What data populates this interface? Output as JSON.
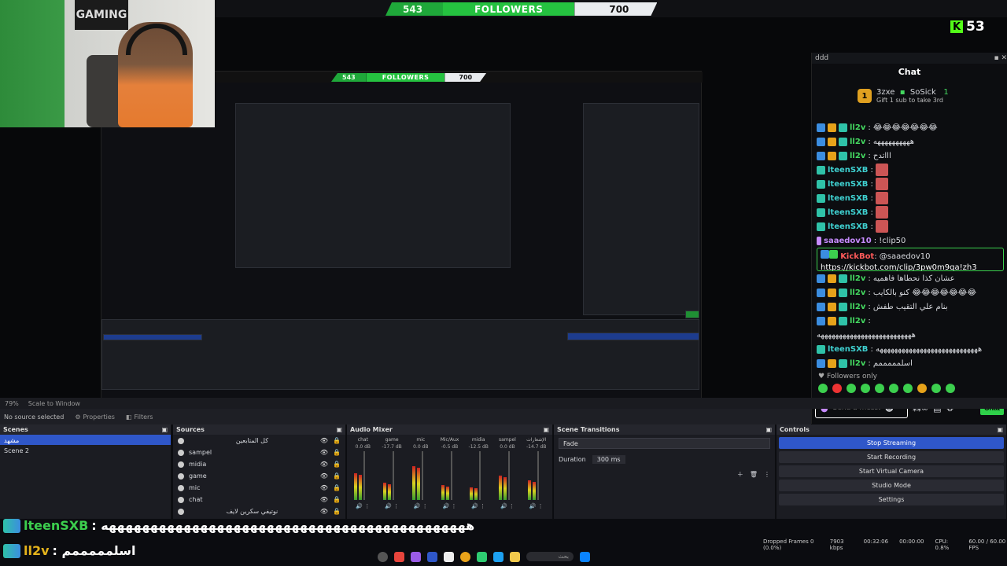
{
  "followers_bar": {
    "current": "543",
    "label": "FOLLOWERS",
    "goal": "700"
  },
  "nested_followers_bar": {
    "current": "543",
    "label": "FOLLOWERS",
    "goal": "700"
  },
  "webcam": {
    "sign_text": "GAMING"
  },
  "kick": {
    "logo": "K",
    "count": "53"
  },
  "chat": {
    "dock_title": "ddd",
    "heading": "Chat",
    "pinned": {
      "badge": "1",
      "user": "3zxe",
      "user2": "SoSick",
      "rank": "1",
      "gift_text": "Gift 1 sub to take 3rd"
    },
    "messages": [
      {
        "user": "ll2v",
        "text": ": 😂😂😂😂😂😂😂",
        "color": "n-green"
      },
      {
        "user": "ll2v",
        "text": ": ههههههههههه",
        "color": "n-green"
      },
      {
        "user": "ll2v",
        "text": ": اااتدح",
        "color": "n-green"
      },
      {
        "user": "lteenSXB",
        "text": ":",
        "color": "n-cyan"
      },
      {
        "user": "lteenSXB",
        "text": ":",
        "color": "n-cyan"
      },
      {
        "user": "lteenSXB",
        "text": ":",
        "color": "n-cyan"
      },
      {
        "user": "lteenSXB",
        "text": ":",
        "color": "n-cyan"
      },
      {
        "user": "lteenSXB",
        "text": ":",
        "color": "n-cyan"
      },
      {
        "user": "saaedov10",
        "text": ": !clip50",
        "color": "n-purple"
      }
    ],
    "highlight": {
      "user": "KickBot",
      "text": ": @saaedov10",
      "link": "https://kickbot.com/clip/3pw0m9qa!zh3"
    },
    "messages2": [
      {
        "user": "ll2v",
        "text": ": عشان كذا نحطاها فاهميه",
        "color": "n-green"
      },
      {
        "user": "ll2v",
        "text": ": كنو بالكايب 😂😂😂😂😂😂😂",
        "color": "n-green"
      },
      {
        "user": "ll2v",
        "text": ": بنام علي التقيب طفش",
        "color": "n-green"
      },
      {
        "user": "ll2v",
        "text": ":",
        "color": "n-green"
      },
      {
        "user": "",
        "text": "ههههههههههههههههههههههههههه",
        "color": "n-green"
      },
      {
        "user": "lteenSXB",
        "text": ": ههههههههههههههههههههههههههههه",
        "color": "n-cyan"
      },
      {
        "user": "ll2v",
        "text": ": اسلمممممم",
        "color": "n-green"
      }
    ],
    "followers_only": "Followers only",
    "composer_placeholder": "Send a message",
    "chat_button": "Chat"
  },
  "obs": {
    "zoom": "79%",
    "scale": "Scale to Window",
    "no_source": "No source selected",
    "properties": "Properties",
    "filters": "Filters",
    "scenes_title": "Scenes",
    "scenes": [
      "مشهد",
      "Scene 2"
    ],
    "sources_title": "Sources",
    "sources": [
      "كل المتابعين",
      "sampel",
      "midia",
      "game",
      "mic",
      "chat",
      "نوتيفي سكرين لايف"
    ],
    "mixer_title": "Audio Mixer",
    "mixer": [
      {
        "name": "chat",
        "db": "0.0 dB",
        "level": 0.55
      },
      {
        "name": "game",
        "db": "-17.7 dB",
        "level": 0.35
      },
      {
        "name": "mic",
        "db": "0.0 dB",
        "level": 0.7
      },
      {
        "name": "Mic/Aux",
        "db": "-0.5 dB",
        "level": 0.3
      },
      {
        "name": "midia",
        "db": "-12.5 dB",
        "level": 0.25
      },
      {
        "name": "sampel",
        "db": "0.0 dB",
        "level": 0.5
      },
      {
        "name": "الإشعارات",
        "db": "-14.7 dB",
        "level": 0.4
      }
    ],
    "transitions_title": "Scene Transitions",
    "transition": "Fade",
    "duration_label": "Duration",
    "duration": "300 ms",
    "controls_title": "Controls",
    "controls": [
      "Stop Streaming",
      "Start Recording",
      "Start Virtual Camera",
      "Studio Mode",
      "Settings"
    ],
    "status": {
      "dropped": "Dropped Frames 0 (0.0%)",
      "kbps": "7903 kbps",
      "time": "00:32:06",
      "rec": "00:00:00",
      "cpu": "CPU: 0.8%",
      "fps": "60.00 / 60.00 FPS"
    }
  },
  "overlay": {
    "line1_user": "lteenSXB",
    "line1_text": ": ههههههههههههههههههههههههههههههههههههههههههههه",
    "line2_user": "ll2v",
    "line2_text": ": اسلمممممم"
  },
  "taskbar": {
    "search": "بحث"
  },
  "colors": {
    "accent": "#2f57c9",
    "kick_green": "#53fc18",
    "followers_green": "#25c240"
  }
}
